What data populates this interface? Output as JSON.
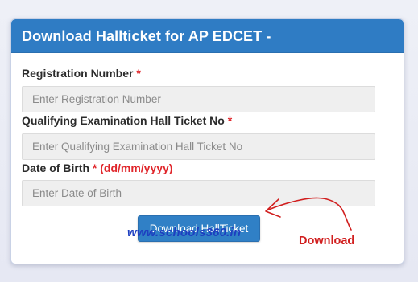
{
  "form": {
    "title": "Download Hallticket for AP EDCET -",
    "required_mark": "*",
    "fields": [
      {
        "label": "Registration Number",
        "placeholder": "Enter Registration Number",
        "value": ""
      },
      {
        "label": "Qualifying Examination Hall Ticket No",
        "placeholder": "Enter Qualifying Examination Hall Ticket No",
        "value": ""
      },
      {
        "label": "Date of Birth",
        "hint": "(dd/mm/yyyy)",
        "placeholder": "Enter Date of Birth",
        "value": ""
      }
    ],
    "submit_label": "Download HallTicket"
  },
  "overlay": {
    "watermark": "www.schools360.in",
    "annotation": "Download",
    "annotation_color": "#d11f1f",
    "watermark_color": "#1d3fc0"
  },
  "colors": {
    "header": "#2f7cc4",
    "button": "#3080c6",
    "required": "#e0262b"
  }
}
